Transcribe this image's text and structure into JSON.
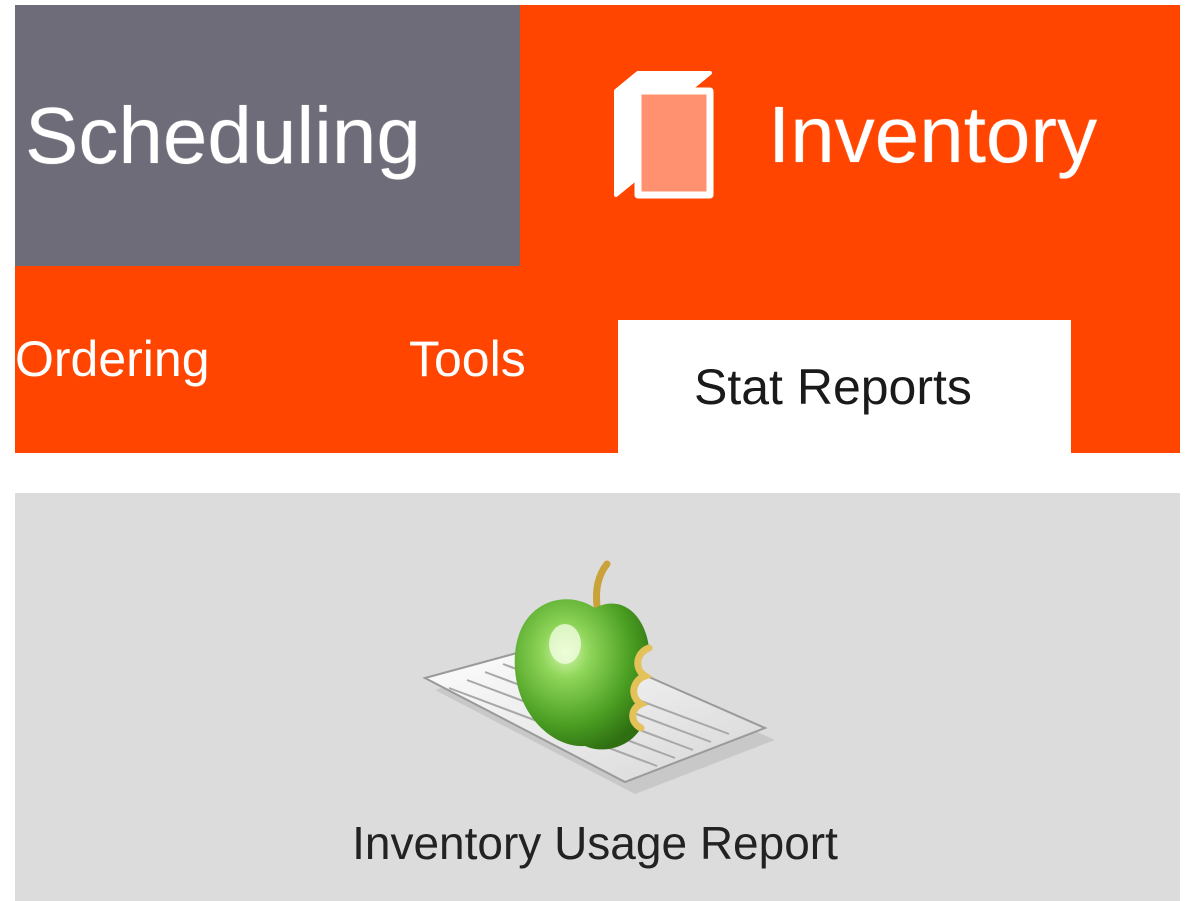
{
  "modules": {
    "scheduling": {
      "label": "Scheduling"
    },
    "inventory": {
      "label": "Inventory",
      "icon": "box-icon",
      "active": true
    }
  },
  "subnav": {
    "items": [
      {
        "label": "Ordering"
      },
      {
        "label": "Tools"
      },
      {
        "label": "Stat Reports",
        "active": true
      }
    ]
  },
  "reports": [
    {
      "label": "Inventory Usage Report",
      "icon": "apple-report-icon"
    }
  ],
  "colors": {
    "accent": "#ff4500",
    "inactive_module": "#6d6c78",
    "panel": "#dcdcdc"
  }
}
